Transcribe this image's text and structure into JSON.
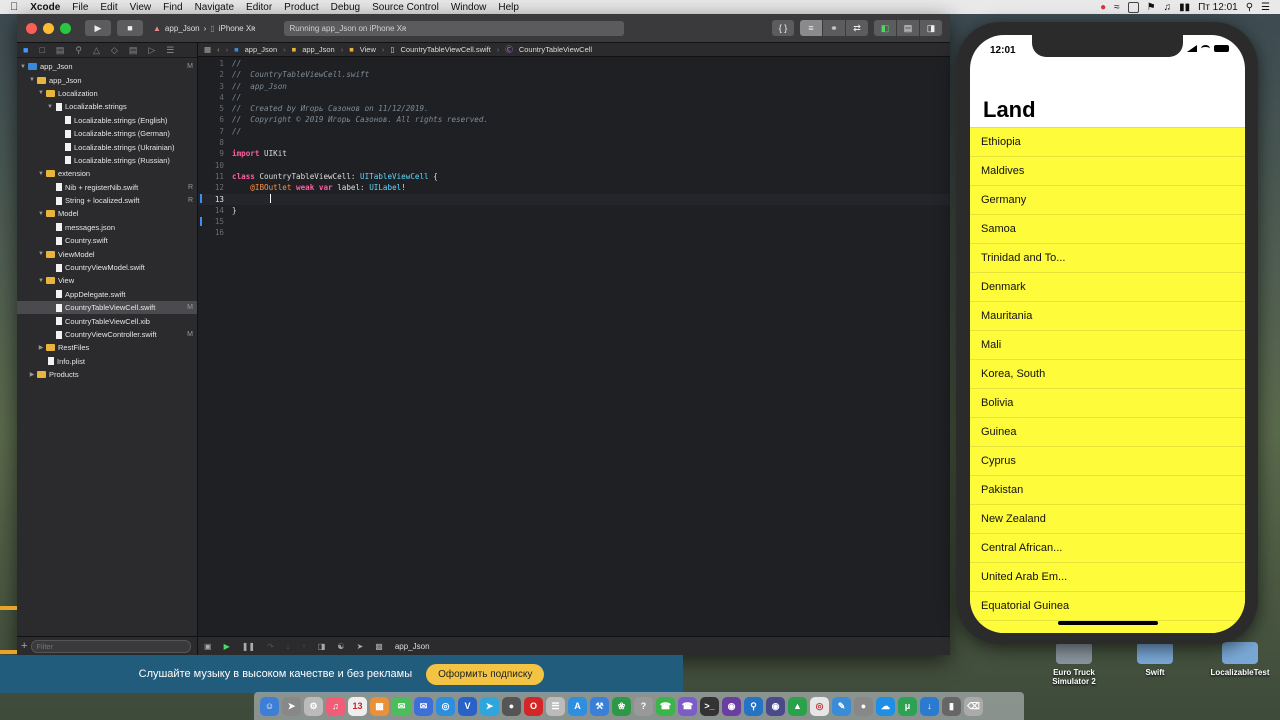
{
  "menubar": {
    "app_name": "Xcode",
    "items": [
      "File",
      "Edit",
      "View",
      "Find",
      "Navigate",
      "Editor",
      "Product",
      "Debug",
      "Source Control",
      "Window",
      "Help"
    ],
    "clock": "Пт 12:01"
  },
  "toolbar": {
    "scheme": "app_Json",
    "device": "iPhone Xʀ",
    "activity": "Running app_Json on iPhone Xʀ"
  },
  "jumpbar": {
    "path": [
      "app_Json",
      "app_Json",
      "View",
      "CountryTableViewCell.swift",
      "CountryTableViewCell"
    ]
  },
  "navigator": {
    "tree": [
      {
        "label": "app_Json",
        "badge": "M"
      },
      {
        "label": "app_Json",
        "badge": ""
      },
      {
        "label": "Localization",
        "badge": ""
      },
      {
        "label": "Localizable.strings",
        "badge": ""
      },
      {
        "label": "Localizable.strings (English)",
        "badge": ""
      },
      {
        "label": "Localizable.strings (German)",
        "badge": ""
      },
      {
        "label": "Localizable.strings (Ukrainian)",
        "badge": ""
      },
      {
        "label": "Localizable.strings (Russian)",
        "badge": ""
      },
      {
        "label": "extension",
        "badge": ""
      },
      {
        "label": "Nib + registerNib.swift",
        "badge": "R"
      },
      {
        "label": "String + localized.swift",
        "badge": "R"
      },
      {
        "label": "Model",
        "badge": ""
      },
      {
        "label": "messages.json",
        "badge": ""
      },
      {
        "label": "Country.swift",
        "badge": ""
      },
      {
        "label": "ViewModel",
        "badge": ""
      },
      {
        "label": "CountryViewModel.swift",
        "badge": ""
      },
      {
        "label": "View",
        "badge": ""
      },
      {
        "label": "AppDelegate.swift",
        "badge": ""
      },
      {
        "label": "CountryTableViewCell.swift",
        "badge": "M"
      },
      {
        "label": "CountryTableViewCell.xib",
        "badge": ""
      },
      {
        "label": "CountryViewController.swift",
        "badge": "M"
      },
      {
        "label": "RestFiles",
        "badge": ""
      },
      {
        "label": "Info.plist",
        "badge": ""
      },
      {
        "label": "Products",
        "badge": ""
      }
    ],
    "filter_placeholder": "Filter"
  },
  "editor": {
    "line_numbers": [
      "1",
      "2",
      "3",
      "4",
      "5",
      "6",
      "7",
      "8",
      "9",
      "10",
      "11",
      "12",
      "13",
      "14",
      "15",
      "16"
    ],
    "comments": {
      "l1": "//",
      "l2": "//  CountryTableViewCell.swift",
      "l3": "//  app_Json",
      "l4": "//",
      "l5": "//  Created by Игорь Сазонов on 11/12/2019.",
      "l6": "//  Copyright © 2019 Игорь Сазонов. All rights reserved.",
      "l7": "//"
    },
    "import_kw": "import",
    "import_mod": "UIKit",
    "class_kw": "class",
    "class_name": "CountryTableViewCell:",
    "superclass": "UITableViewCell",
    "open_brace": "{",
    "attr": "@IBOutlet",
    "weak_kw": "weak",
    "var_kw": "var",
    "prop": "label:",
    "prop_type": "UILabel",
    "bang": "!",
    "close_brace": "}"
  },
  "statusbar": {
    "target": "app_Json"
  },
  "ad": {
    "text": "Слушайте музыку в высоком качестве и без рекламы",
    "button": "Оформить подписку"
  },
  "desktop_icons": [
    {
      "label": "Euro Truck Simulator 2"
    },
    {
      "label": "Swift"
    },
    {
      "label": "LocalizableTest"
    }
  ],
  "simulator": {
    "time": "12:01",
    "title": "Land",
    "rows": [
      "Ethiopia",
      "Maldives",
      "Germany",
      "Samoa",
      "Trinidad and To...",
      "Denmark",
      "Mauritania",
      "Mali",
      "Korea, South",
      "Bolivia",
      "Guinea",
      "Cyprus",
      "Pakistan",
      "New Zealand",
      "Central African...",
      "United Arab Em...",
      "Equatorial Guinea"
    ],
    "table_color": "#fefb3a"
  },
  "colors": {
    "accent": "#3d9bff",
    "editor_bg": "#1f2024",
    "ad_bg": "#215c7d"
  }
}
